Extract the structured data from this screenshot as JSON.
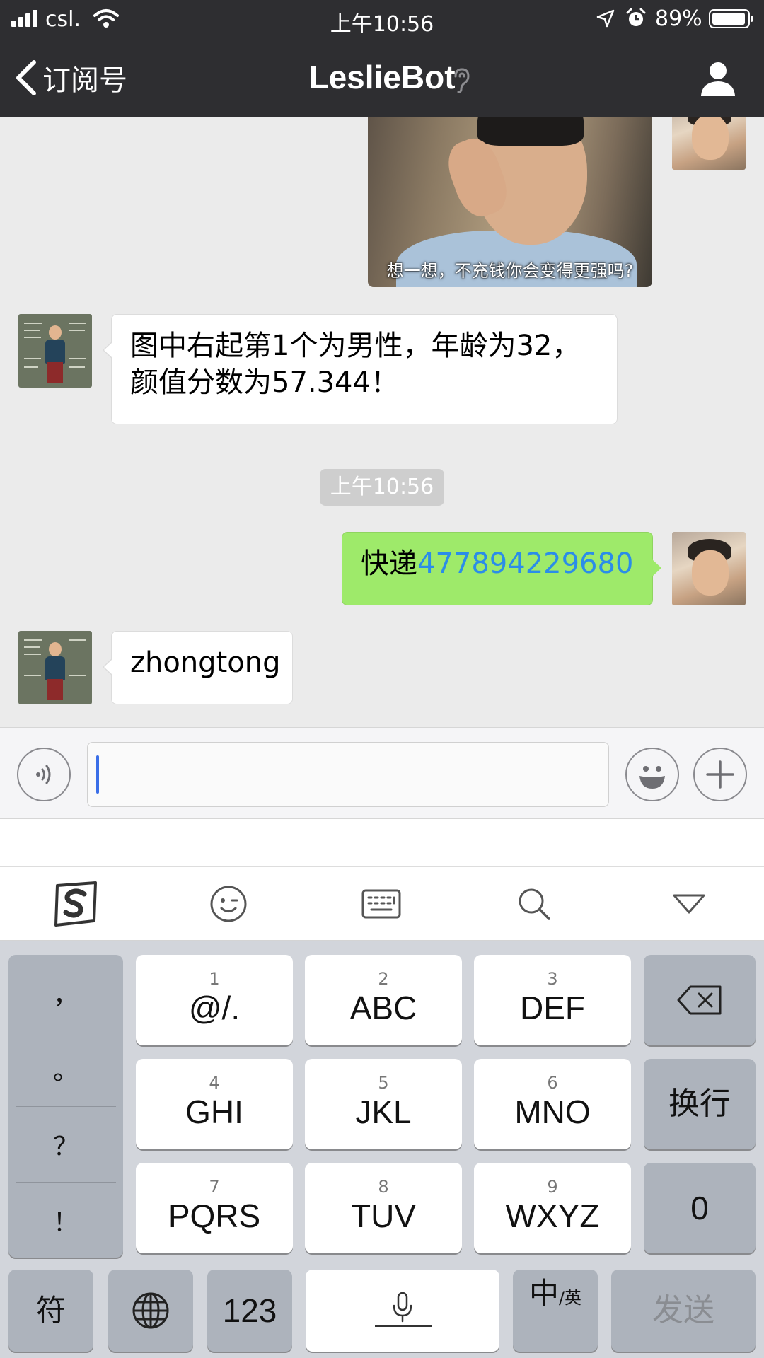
{
  "status_bar": {
    "carrier": "csl.",
    "time": "上午10:56",
    "battery": "89%"
  },
  "nav": {
    "back_label": "订阅号",
    "title": "LeslieBot"
  },
  "chat": {
    "image_caption": "想一想，不充钱你会变得更强吗?",
    "bot_reply_1": "图中右起第1个为男性，年龄为32，\n颜值分数为57.344！",
    "timestamp": "上午10:56",
    "user_msg_prefix": "快递",
    "user_msg_number": "477894229680",
    "bot_reply_2": "zhongtong"
  },
  "input": {
    "value": ""
  },
  "ime_toolbar": {
    "icons": [
      "sogou-logo-icon",
      "emoji-icon",
      "keyboard-icon",
      "search-icon",
      "collapse-icon"
    ]
  },
  "keyboard": {
    "punctuation": [
      "，",
      "。",
      "？",
      "！"
    ],
    "keys": [
      {
        "num": "1",
        "label": "@/."
      },
      {
        "num": "2",
        "label": "ABC"
      },
      {
        "num": "3",
        "label": "DEF"
      },
      {
        "num": "4",
        "label": "GHI"
      },
      {
        "num": "5",
        "label": "JKL"
      },
      {
        "num": "6",
        "label": "MNO"
      },
      {
        "num": "7",
        "label": "PQRS"
      },
      {
        "num": "8",
        "label": "TUV"
      },
      {
        "num": "9",
        "label": "WXYZ"
      }
    ],
    "newline": "换行",
    "zero": "0",
    "symbols": "符",
    "numeric": "123",
    "lang_main": "中",
    "lang_sub": "/英",
    "send": "发送"
  },
  "colors": {
    "nav_background": "#2e2e31",
    "chat_background": "#ebebeb",
    "outgoing_bubble": "#9eea6a",
    "link": "#2b8de8"
  }
}
